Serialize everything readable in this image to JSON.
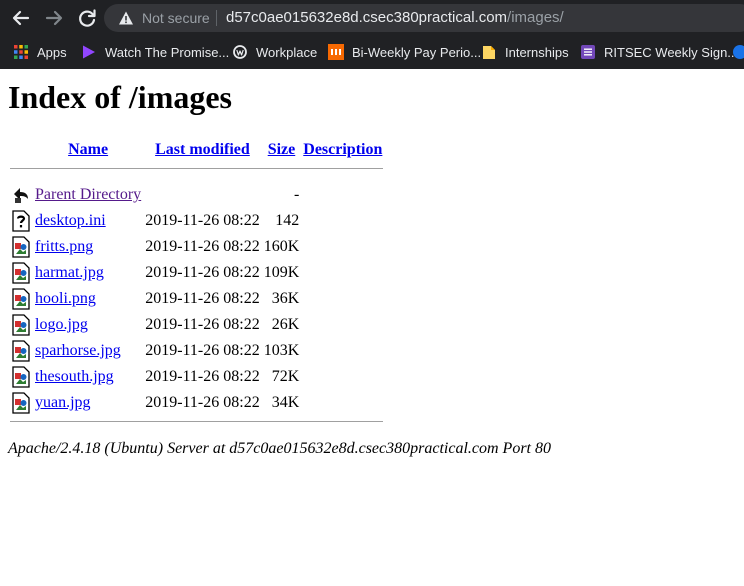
{
  "browser": {
    "security_label": "Not secure",
    "url_host": "d57c0ae015632e8d.csec380practical.com",
    "url_path": "/images/",
    "bookmarks": [
      {
        "label": "Apps",
        "icon": "apps-grid-icon"
      },
      {
        "label": "Watch The Promise...",
        "icon": "play-icon"
      },
      {
        "label": "Workplace",
        "icon": "workplace-icon"
      },
      {
        "label": "Bi-Weekly Pay Perio...",
        "icon": "rit-icon"
      },
      {
        "label": "Internships",
        "icon": "folder-icon"
      },
      {
        "label": "RITSEC Weekly Sign...",
        "icon": "form-icon"
      }
    ]
  },
  "page": {
    "title": "Index of /images",
    "columns": {
      "name": "Name",
      "last_modified": "Last modified",
      "size": "Size",
      "description": "Description"
    },
    "parent": {
      "name": "Parent Directory",
      "size": "-",
      "icon": "back-arrow-icon"
    },
    "files": [
      {
        "name": "desktop.ini",
        "modified": "2019-11-26 08:22",
        "size": "142",
        "icon": "unknown-file-icon"
      },
      {
        "name": "fritts.png",
        "modified": "2019-11-26 08:22",
        "size": "160K",
        "icon": "image-file-icon"
      },
      {
        "name": "harmat.jpg",
        "modified": "2019-11-26 08:22",
        "size": "109K",
        "icon": "image-file-icon"
      },
      {
        "name": "hooli.png",
        "modified": "2019-11-26 08:22",
        "size": "36K",
        "icon": "image-file-icon"
      },
      {
        "name": "logo.jpg",
        "modified": "2019-11-26 08:22",
        "size": "26K",
        "icon": "image-file-icon"
      },
      {
        "name": "sparhorse.jpg",
        "modified": "2019-11-26 08:22",
        "size": "103K",
        "icon": "image-file-icon"
      },
      {
        "name": "thesouth.jpg",
        "modified": "2019-11-26 08:22",
        "size": "72K",
        "icon": "image-file-icon"
      },
      {
        "name": "yuan.jpg",
        "modified": "2019-11-26 08:22",
        "size": "34K",
        "icon": "image-file-icon"
      }
    ],
    "footer": "Apache/2.4.18 (Ubuntu) Server at d57c0ae015632e8d.csec380practical.com Port 80"
  }
}
